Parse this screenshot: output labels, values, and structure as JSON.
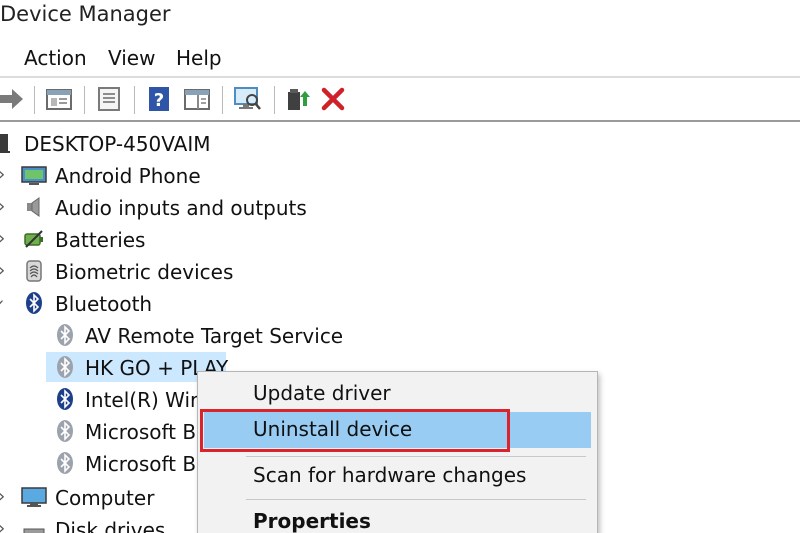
{
  "window": {
    "title": "Device Manager"
  },
  "menu": [
    "Action",
    "View",
    "Help"
  ],
  "toolbar": {
    "icons": [
      "forward-arrow-icon",
      "properties-pane-icon",
      "show-hidden-icon",
      "help-icon",
      "columns-icon",
      "scan-hardware-icon",
      "update-driver-icon",
      "uninstall-icon"
    ]
  },
  "tree": {
    "root": "DESKTOP-450VAIM",
    "categories": [
      {
        "label": "Android Phone",
        "icon": "phone-monitor-icon"
      },
      {
        "label": "Audio inputs and outputs",
        "icon": "speaker-icon"
      },
      {
        "label": "Batteries",
        "icon": "battery-icon"
      },
      {
        "label": "Biometric devices",
        "icon": "fingerprint-icon"
      },
      {
        "label": "Bluetooth",
        "icon": "bluetooth-icon"
      }
    ],
    "bluetooth_children": [
      "AV Remote Target Service",
      "HK GO + PLAY",
      "Intel(R) Wire",
      "Microsoft Bl",
      "Microsoft Bl"
    ],
    "after": [
      {
        "label": "Computer",
        "icon": "monitor-icon"
      },
      {
        "label": "Disk drives",
        "icon": "disk-icon"
      }
    ]
  },
  "context_menu": {
    "items": [
      "Update driver",
      "Uninstall device",
      "Scan for hardware changes",
      "Properties"
    ],
    "highlighted": "Uninstall device"
  },
  "colors": {
    "highlight": "#99ccf3",
    "annotation": "#d9232d",
    "selection": "#cce8ff"
  }
}
